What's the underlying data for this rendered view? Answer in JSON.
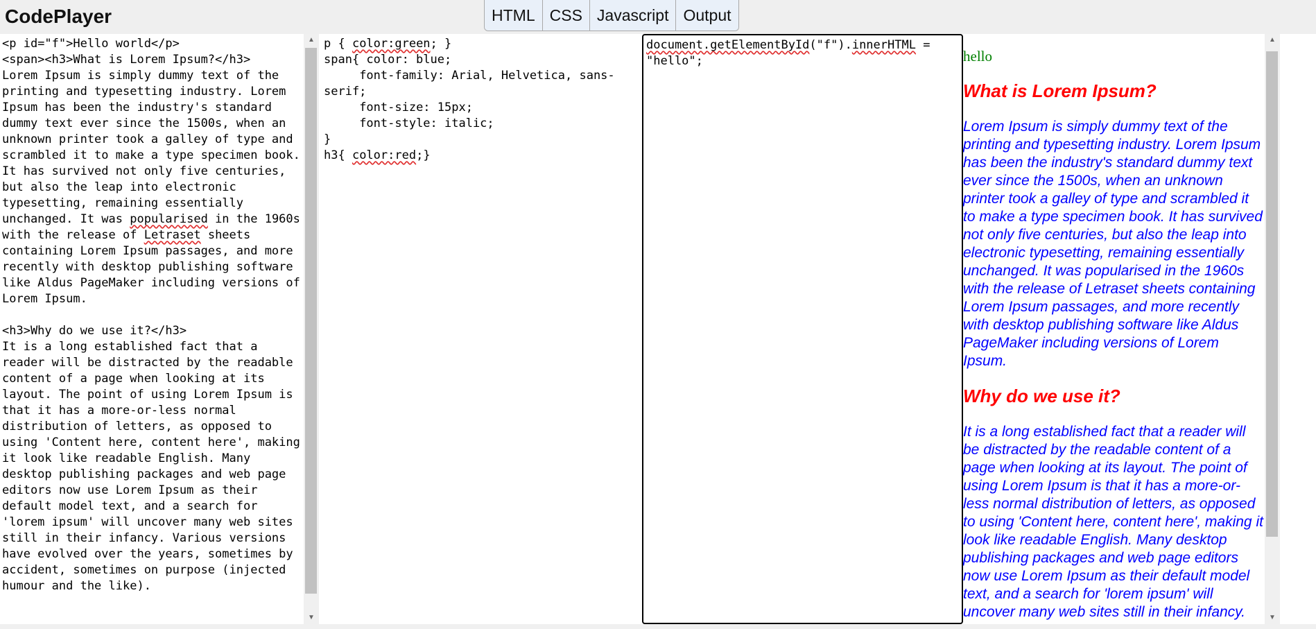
{
  "app": {
    "title": "CodePlayer",
    "toggles": [
      "HTML",
      "CSS",
      "Javascript",
      "Output"
    ]
  },
  "html_editor": {
    "lines": [
      "<p id=\"f\">Hello world</p>",
      "<span><h3>What is Lorem Ipsum?</h3>",
      "Lorem Ipsum is simply dummy text of the printing and typesetting industry. Lorem Ipsum has been the industry's standard dummy text ever since the 1500s, when an unknown printer took a galley of type and scrambled it to make a type specimen book. It has survived not only five centuries, but also the leap into electronic typesetting, remaining essentially unchanged. It was popularised in the 1960s with the release of Letraset sheets containing Lorem Ipsum passages, and more recently with desktop publishing software like Aldus PageMaker including versions of Lorem Ipsum.",
      "",
      "<h3>Why do we use it?</h3>",
      "It is a long established fact that a reader will be distracted by the readable content of a page when looking at its layout. The point of using Lorem Ipsum is that it has a more-or-less normal distribution of letters, as opposed to using 'Content here, content here', making it look like readable English. Many desktop publishing packages and web page editors now use Lorem Ipsum as their default model text, and a search for 'lorem ipsum' will uncover many web sites still in their infancy. Various versions have evolved over the years, sometimes by accident, sometimes on purpose (injected humour and the like)."
    ]
  },
  "css_editor": {
    "lines": [
      "p { color:green; }",
      "span{ color: blue;",
      "     font-family: Arial, Helvetica, sans-serif;",
      "     font-size: 15px;",
      "     font-style: italic;",
      "}",
      "h3{ color:red;}"
    ]
  },
  "js_editor": {
    "code": "document.getElementById(\"f\").innerHTML = \"hello\";"
  },
  "output": {
    "p_text": "hello",
    "h3_1": "What is Lorem Ipsum?",
    "para_1": "Lorem Ipsum is simply dummy text of the printing and typesetting industry. Lorem Ipsum has been the industry's standard dummy text ever since the 1500s, when an unknown printer took a galley of type and scrambled it to make a type specimen book. It has survived not only five centuries, but also the leap into electronic typesetting, remaining essentially unchanged. It was popularised in the 1960s with the release of Letraset sheets containing Lorem Ipsum passages, and more recently with desktop publishing software like Aldus PageMaker including versions of Lorem Ipsum.",
    "h3_2": "Why do we use it?",
    "para_2": "It is a long established fact that a reader will be distracted by the readable content of a page when looking at its layout. The point of using Lorem Ipsum is that it has a more-or-less normal distribution of letters, as opposed to using 'Content here, content here', making it look like readable English. Many desktop publishing packages and web page editors now use Lorem Ipsum as their default model text, and a search for 'lorem ipsum' will uncover many web sites still in their infancy."
  },
  "colors": {
    "topbar": "#efefef",
    "toggle_bg": "#e9f0f9",
    "output_p": "#008000",
    "output_span": "#0000ff",
    "output_h3": "#ff0000",
    "spellcheck": "#e03030"
  }
}
